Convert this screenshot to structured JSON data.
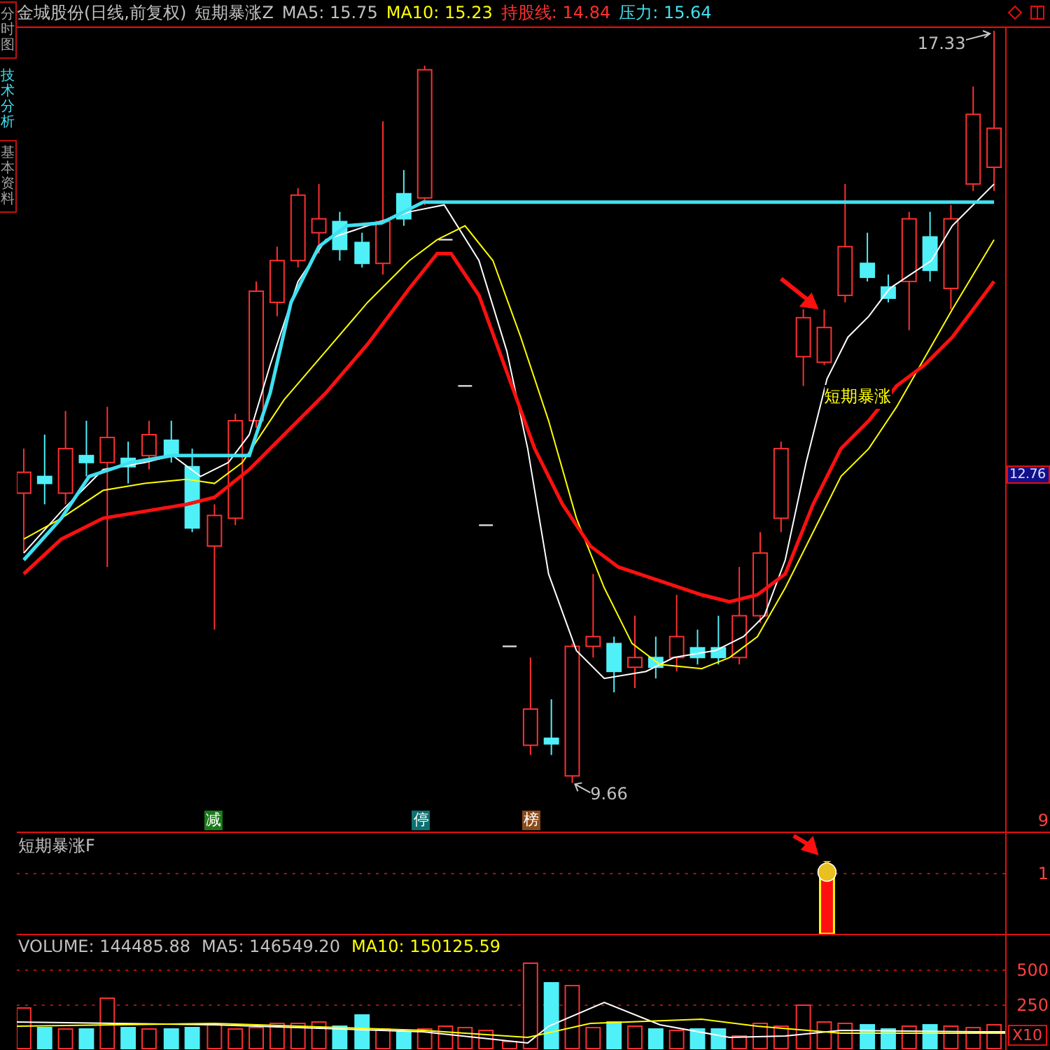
{
  "side_tabs": [
    {
      "label": "分时图",
      "selected": false
    },
    {
      "label": "技术分析",
      "selected": true
    },
    {
      "label": "基本资料",
      "selected": false
    }
  ],
  "header": {
    "items": [
      {
        "text": "金城股份(日线,前复权)",
        "color": "#c0c0c0"
      },
      {
        "text": "短期暴涨Z",
        "color": "#c0c0c0"
      },
      {
        "text": "MA5: 15.75",
        "color": "#c0c0c0"
      },
      {
        "text": "MA10: 15.23",
        "color": "#ffff00"
      },
      {
        "text": "持股线: 14.84",
        "color": "#ff3030"
      },
      {
        "text": "压力: 15.64",
        "color": "#40e0f0"
      }
    ]
  },
  "price_panel": {
    "high_label": "17.33",
    "low_label": "9.66",
    "signal_label": "短期暴涨",
    "badges": [
      {
        "text": "减",
        "color": "#1a7a1a"
      },
      {
        "text": "停",
        "color": "#0f7070"
      },
      {
        "text": "榜",
        "color": "#8a4a1a"
      }
    ],
    "axis": {
      "current": "12.76",
      "ticks": [
        "9"
      ]
    }
  },
  "indicator_panel": {
    "title": "短期暴涨F",
    "axis": [
      "1"
    ]
  },
  "volume_panel": {
    "items": [
      {
        "text": "VOLUME: 144485.88",
        "color": "#c0c0c0"
      },
      {
        "text": "MA5: 146549.20",
        "color": "#c0c0c0"
      },
      {
        "text": "MA10: 150125.59",
        "color": "#ffff00"
      }
    ],
    "axis": [
      "500",
      "250"
    ],
    "scale_button": "X10"
  }
}
